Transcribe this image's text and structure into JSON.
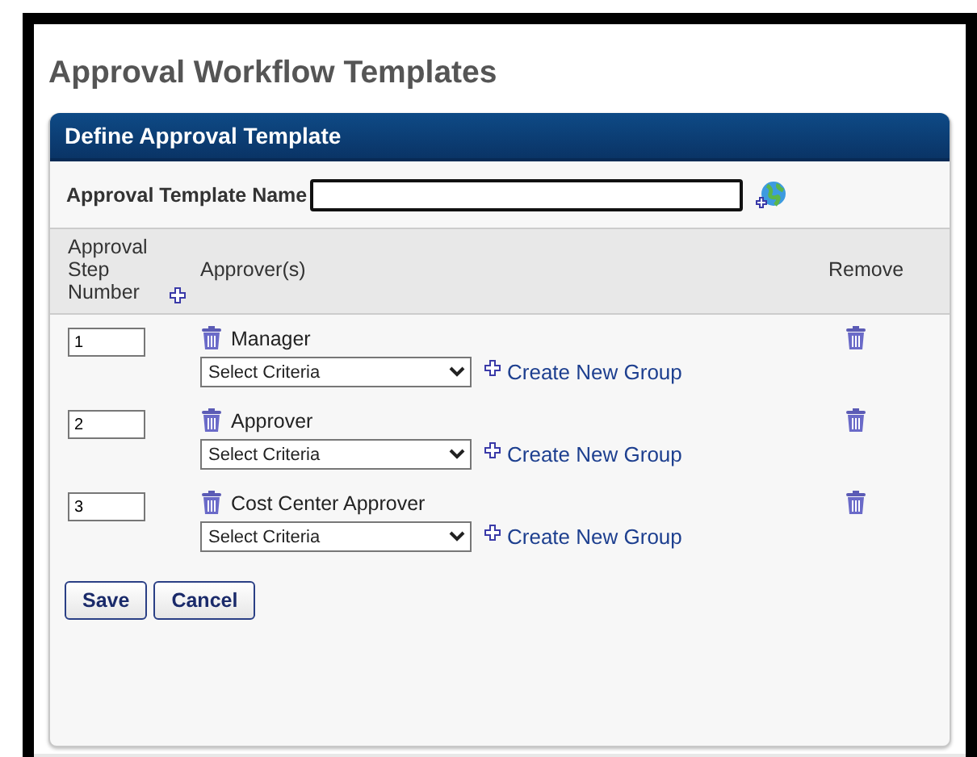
{
  "page_title": "Approval Workflow Templates",
  "panel": {
    "title": "Define Approval Template",
    "template_name": {
      "label": "Approval Template Name"
    },
    "columns": [
      "Approval Step Number",
      "Approver(s)",
      "Remove"
    ],
    "steps": [
      {
        "number": "1",
        "approver": "Manager",
        "criteria": "Select Criteria",
        "link": "Create New Group"
      },
      {
        "number": "2",
        "approver": "Approver",
        "criteria": "Select Criteria",
        "link": "Create New Group"
      },
      {
        "number": "3",
        "approver": "Cost Center Approver",
        "criteria": "Select Criteria",
        "link": "Create New Group"
      }
    ],
    "buttons": [
      "Save",
      "Cancel"
    ]
  }
}
